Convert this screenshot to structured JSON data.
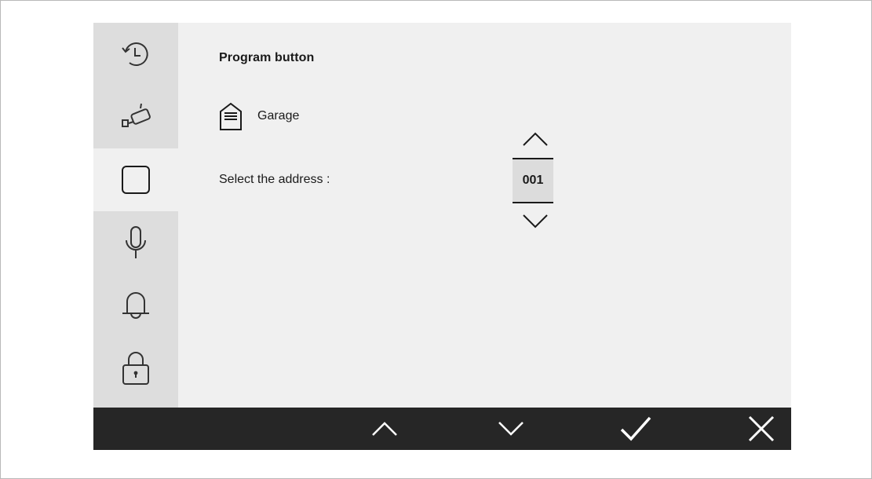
{
  "screen": {
    "title": "Program button",
    "device": {
      "icon": "garage-door-icon",
      "label": "Garage"
    },
    "address": {
      "label": "Select the address :",
      "value": "001"
    }
  },
  "sidebar": {
    "items": [
      {
        "icon": "history-icon",
        "active": false
      },
      {
        "icon": "camera-icon",
        "active": false
      },
      {
        "icon": "program-button-icon",
        "active": true
      },
      {
        "icon": "microphone-icon",
        "active": false
      },
      {
        "icon": "bell-icon",
        "active": false
      },
      {
        "icon": "lock-icon",
        "active": false
      }
    ]
  },
  "bottom_bar": {
    "buttons": [
      {
        "icon": "chevron-up-icon"
      },
      {
        "icon": "chevron-down-icon"
      },
      {
        "icon": "checkmark-icon"
      },
      {
        "icon": "close-icon"
      }
    ]
  },
  "colors": {
    "background": "#f0f0f0",
    "sidebar": "#dddddd",
    "bottom_bar": "#262626",
    "selected_value_bg": "#dcdcdc",
    "text": "#1a1a1a"
  }
}
